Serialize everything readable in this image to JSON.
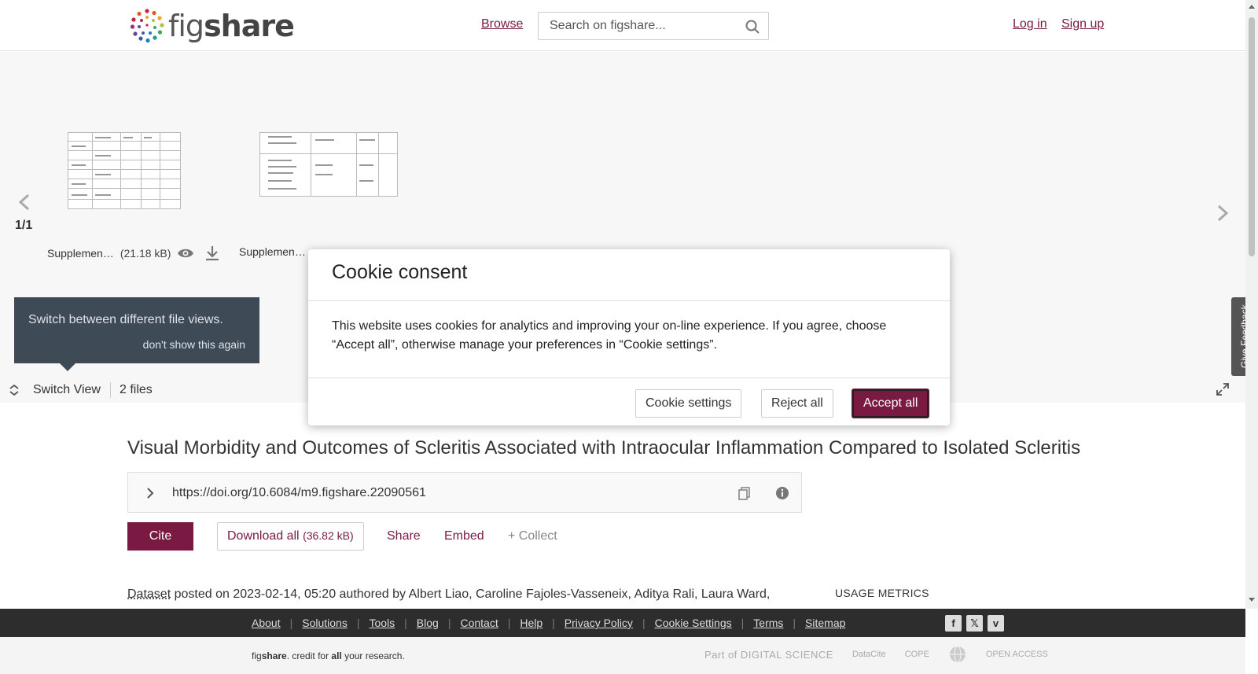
{
  "header": {
    "logo_text_light": "fig",
    "logo_text_bold": "share",
    "browse": "Browse",
    "search_placeholder": "Search on figshare...",
    "login": "Log in",
    "signup": "Sign up"
  },
  "viewer": {
    "page_count": "1/1",
    "files": [
      {
        "name": "Supplemen…",
        "size": "(21.18 kB)"
      },
      {
        "name": "Supplemen…",
        "size": ""
      }
    ],
    "tooltip": {
      "message": "Switch between different file views.",
      "dismiss": "don't show this again"
    },
    "switch_view": "Switch View",
    "files_count": "2 files"
  },
  "article": {
    "title": "Visual Morbidity and Outcomes of Scleritis Associated with Intraocular Inflammation Compared to Isolated Scleritis",
    "doi": "https://doi.org/10.6084/m9.figshare.22090561",
    "cite": "Cite",
    "download_all": "Download all",
    "download_size": "(36.82 kB)",
    "share": "Share",
    "embed": "Embed",
    "collect": "+ Collect",
    "meta_type": "Dataset",
    "meta_text": " posted on 2023-02-14, 05:20 authored by Albert Liao, Caroline Fajoles-Vasseneix, Aditya Rali, Laura Ward,",
    "usage_metrics": "USAGE METRICS"
  },
  "footer": {
    "links": [
      "About",
      "Solutions",
      "Tools",
      "Blog",
      "Contact",
      "Help",
      "Privacy Policy",
      "Cookie Settings",
      "Terms",
      "Sitemap"
    ],
    "tagline_fig": "fig",
    "tagline_share": "share",
    "tagline_rest1": ". credit for ",
    "tagline_all": "all",
    "tagline_rest2": " your research.",
    "partners": [
      "Part of DIGITAL SCIENCE",
      "DataCite",
      "COPE",
      "",
      "OPEN ACCESS"
    ]
  },
  "feedback": "Give Feedback",
  "cookie_modal": {
    "title": "Cookie consent",
    "body": "This website uses cookies for analytics and improving your on-line experience. If you agree, choose “Accept all”, otherwise manage your preferences in “Cookie settings”.",
    "settings": "Cookie settings",
    "reject": "Reject all",
    "accept": "Accept all"
  },
  "colors": {
    "brand": "#7a1a43",
    "footer_dark": "#2d2d2d",
    "tooltip_bg": "#3f4a57"
  }
}
